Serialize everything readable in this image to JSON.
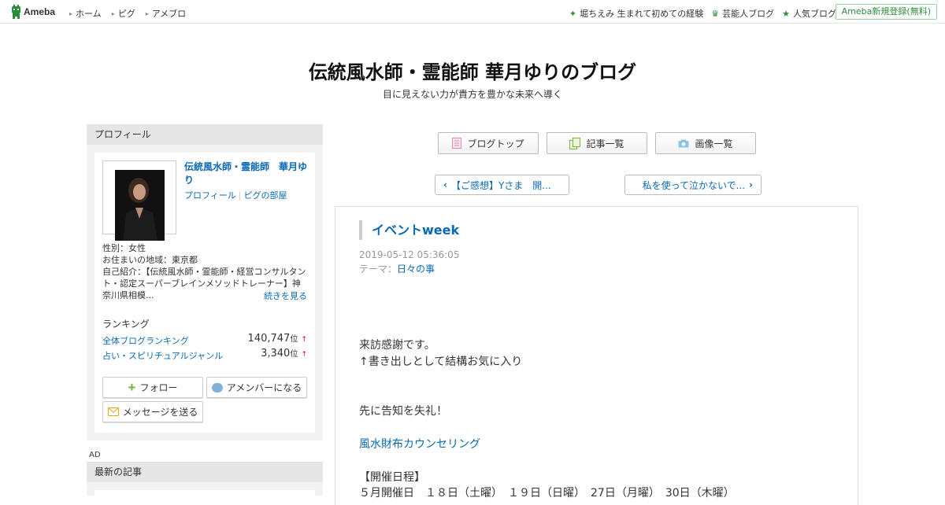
{
  "topbar": {
    "logo_text": "Ameba",
    "nav": [
      "ホーム",
      "ピグ",
      "アメブロ"
    ],
    "right_links": [
      "堀ちえみ 生まれて初めての経験",
      "芸能人ブログ",
      "人気ブログ"
    ],
    "register_label": "Ameba新規登録(無料)"
  },
  "header": {
    "title": "伝統風水師・霊能師 華月ゆりのブログ",
    "description": "目に見えない力が貴方を豊かな未来へ導く"
  },
  "sidebar": {
    "profile_heading": "プロフィール",
    "name": "伝統風水師・霊能師　華月ゆり",
    "link_profile": "プロフィール",
    "link_room": "ピグの部屋",
    "gender": "性別：女性",
    "region": "お住まいの地域：東京都",
    "intro": "自己紹介：【伝統風水師・霊能師・経営コンサルタント・認定スーパーブレインメソッドトレーナー】神奈川県相模...",
    "more": "続きを見る",
    "ranking_title": "ランキング",
    "rankings": [
      {
        "label": "全体ブログランキング",
        "value": "140,747",
        "unit": "位",
        "trend": "↑"
      },
      {
        "label": "占い・スピリチュアルジャンル",
        "value": "3,340",
        "unit": "位",
        "trend": "↑"
      }
    ],
    "follow_label": "フォロー",
    "amember_label": "アメンバーになる",
    "message_label": "メッセージを送る",
    "ad_label": "AD",
    "recent_heading": "最新の記事"
  },
  "main": {
    "nav_buttons": [
      "ブログトップ",
      "記事一覧",
      "画像一覧"
    ],
    "prev_article": "【ご感想】Yさま　開...",
    "next_article": "私を使って泣かないで...",
    "article": {
      "title": "イベントweek",
      "date": "2019-05-12 05:36:05",
      "theme_label": "テーマ：",
      "theme": "日々の事",
      "lines": [
        "来訪感謝です。",
        "↑書き出しとして結構お気に入り",
        "先に告知を失礼！",
        "風水財布カウンセリング",
        "【開催日程】",
        "５月開催日　１８日（土曜）　１９日（日曜）　27日（月曜）　30日（木曜）"
      ]
    }
  },
  "colors": {
    "link": "#0a69b4",
    "ameba_green": "#2d8c3c",
    "sidebar_bg": "#f2f2f2"
  }
}
